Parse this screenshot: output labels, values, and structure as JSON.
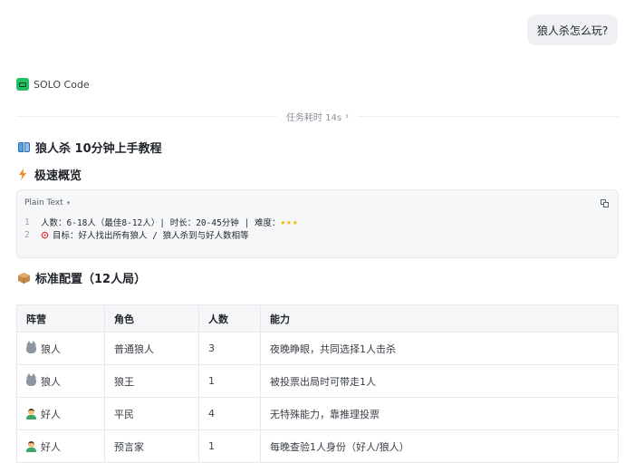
{
  "user_message": "狼人杀怎么玩?",
  "agent": {
    "name": "SOLO Code",
    "logo_color": "#20c163"
  },
  "task_time": "任务耗时 14s",
  "doc_title": "狼人杀 10分钟上手教程",
  "sections": {
    "overview": "极速概览",
    "config": "标准配置（12人局）"
  },
  "code_block": {
    "language": "Plain Text",
    "lines": [
      {
        "no": "1",
        "text": "人数：6-18人（最佳8-12人）| 时长：20-45分钟 | 难度：",
        "stars": "★★★"
      },
      {
        "no": "2",
        "text": "目标：好人找出所有狼人 / 狼人杀到与好人数相等"
      }
    ]
  },
  "table": {
    "headers": [
      "阵营",
      "角色",
      "人数",
      "能力"
    ],
    "rows": [
      {
        "camp": "狼人",
        "camp_icon": "wolf-icon",
        "role": "普通狼人",
        "count": "3",
        "ability": "夜晚睁眼，共同选择1人击杀"
      },
      {
        "camp": "狼人",
        "camp_icon": "wolf-icon",
        "role": "狼王",
        "count": "1",
        "ability": "被投票出局时可带走1人"
      },
      {
        "camp": "好人",
        "camp_icon": "person-icon",
        "role": "平民",
        "count": "4",
        "ability": "无特殊能力，靠推理投票"
      },
      {
        "camp": "好人",
        "camp_icon": "person-icon",
        "role": "预言家",
        "count": "1",
        "ability": "每晚查验1人身份（好人/狼人）"
      }
    ]
  }
}
